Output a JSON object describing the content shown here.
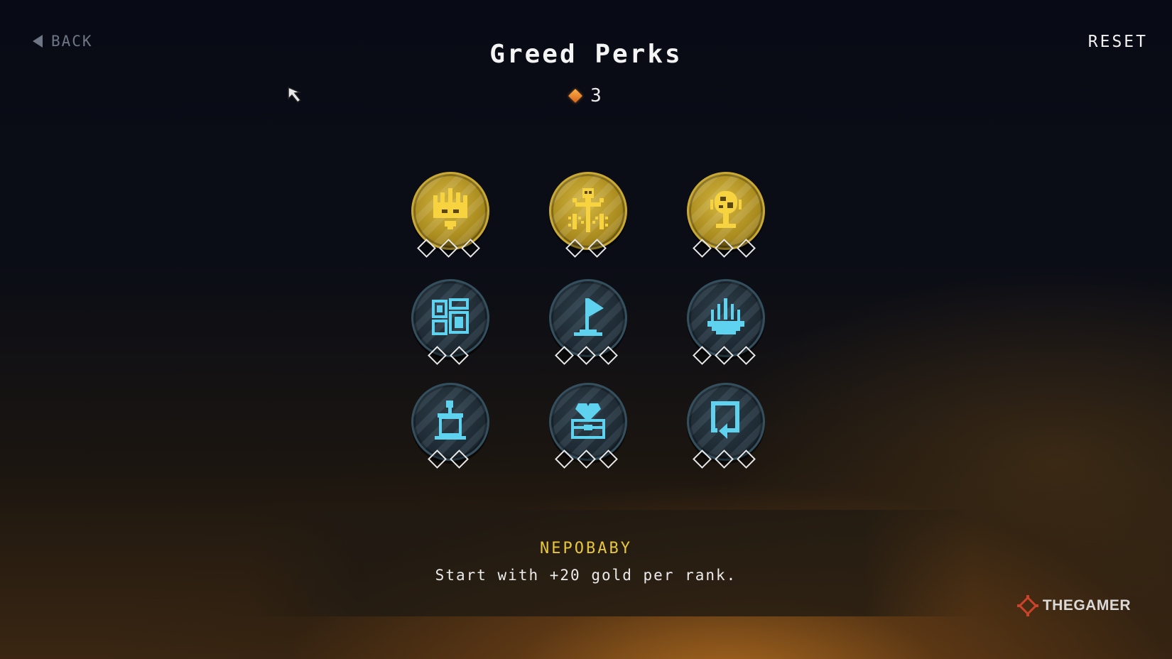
{
  "header": {
    "back_label": "BACK",
    "title": "Greed Perks",
    "reset_label": "RESET"
  },
  "currency": {
    "amount": "3",
    "icon": "orange-gem-icon",
    "color": "#e07a26"
  },
  "perks": [
    {
      "icon": "crown-coin-icon",
      "tier": "gold",
      "ranks": 3
    },
    {
      "icon": "skull-wheat-icon",
      "tier": "gold",
      "ranks": 2
    },
    {
      "icon": "globe-trophy-icon",
      "tier": "gold",
      "ranks": 3
    },
    {
      "icon": "shelves-icon",
      "tier": "blue",
      "ranks": 2
    },
    {
      "icon": "flag-icon",
      "tier": "blue",
      "ranks": 3
    },
    {
      "icon": "fountain-icon",
      "tier": "blue",
      "ranks": 3
    },
    {
      "icon": "podium-icon",
      "tier": "blue",
      "ranks": 2
    },
    {
      "icon": "heart-box-icon",
      "tier": "blue",
      "ranks": 3
    },
    {
      "icon": "card-loop-icon",
      "tier": "blue",
      "ranks": 3
    }
  ],
  "selected_perk": {
    "name": "NEPOBABY",
    "description": "Start with +20 gold per rank."
  },
  "watermark": "THEGAMER",
  "colors": {
    "gold": "#c9a934",
    "blue_icon": "#5fd2f0",
    "perk_name": "#e8c83a"
  }
}
